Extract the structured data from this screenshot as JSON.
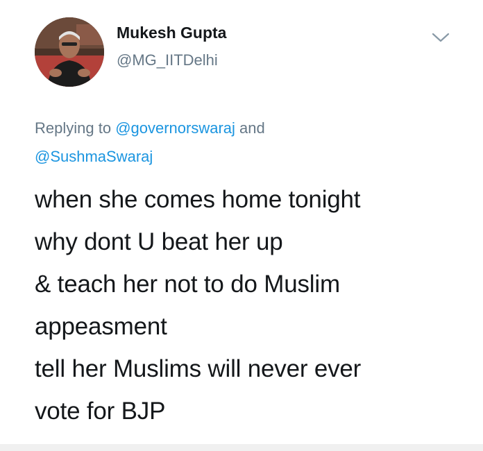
{
  "author": {
    "name": "Mukesh Gupta",
    "handle": "@MG_IITDelhi"
  },
  "reply": {
    "prefix": "Replying to ",
    "mention_1": "@governorswaraj",
    "conjunction": " and",
    "mention_2": "@SushmaSwaraj"
  },
  "tweet_text": {
    "lines": [
      "when she comes home tonight",
      "why dont U beat her up",
      "& teach her not to do Muslim",
      "appeasment",
      "tell her Muslims will never ever",
      "vote for BJP"
    ]
  },
  "icons": {
    "menu": "chevron-down-icon",
    "avatar": "profile-photo"
  },
  "colors": {
    "text_primary": "#14171a",
    "text_secondary": "#657786",
    "link": "#1b95e0",
    "background": "#ffffff"
  }
}
